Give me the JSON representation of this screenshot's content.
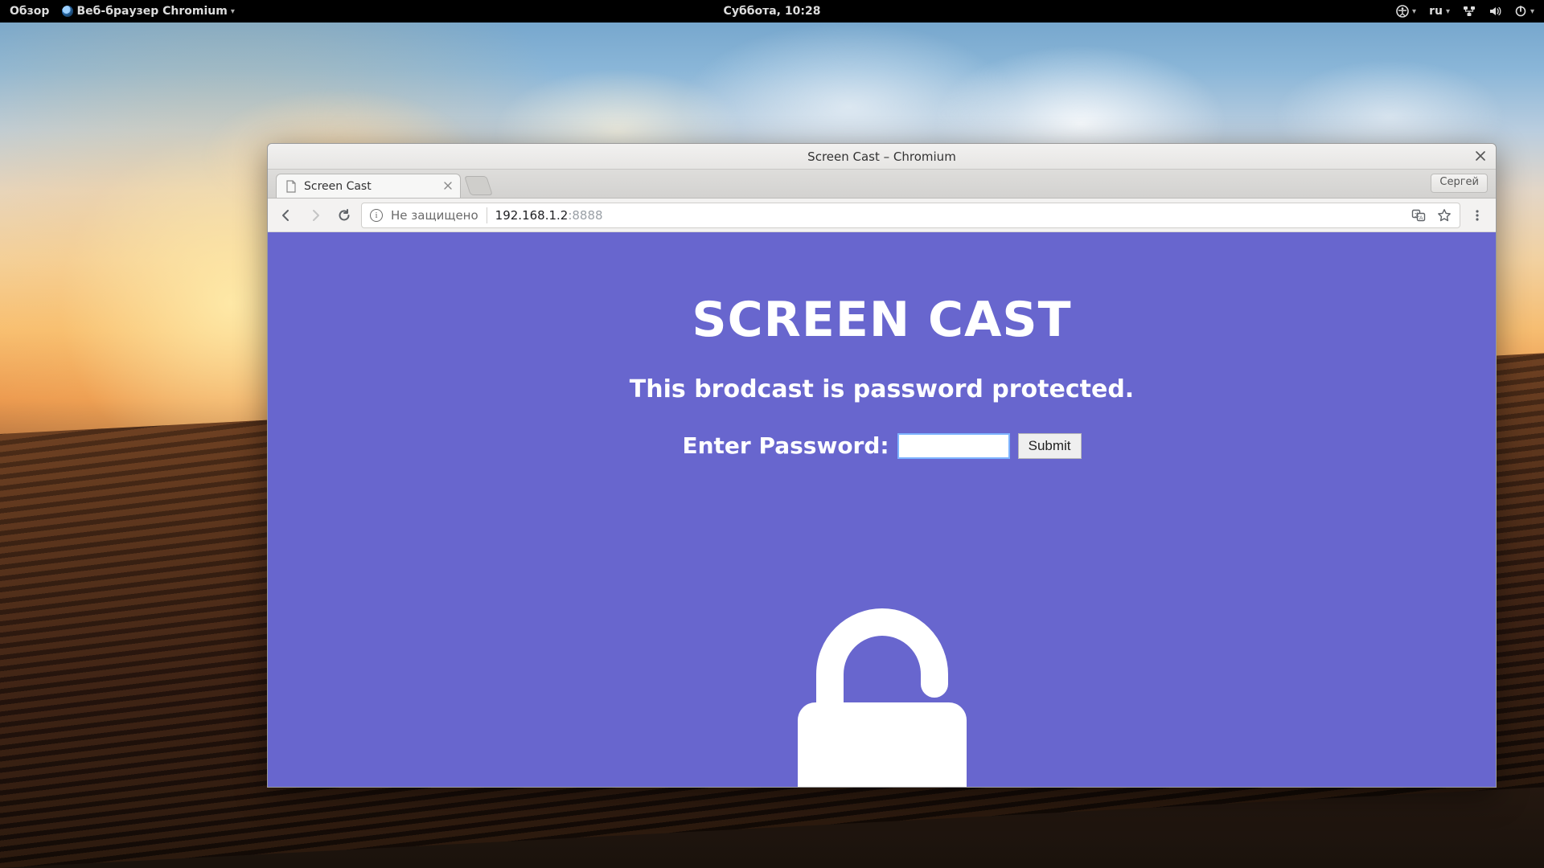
{
  "topbar": {
    "overview": "Обзор",
    "app_label": "Веб-браузер Chromium",
    "clock": "Суббота, 10:28",
    "lang": "ru"
  },
  "window": {
    "title": "Screen Cast – Chromium",
    "tab_title": "Screen Cast",
    "user_chip": "Сергей"
  },
  "omnibox": {
    "not_secure": "Не защищено",
    "host": "192.168.1.2",
    "port": ":8888"
  },
  "page": {
    "heading": "SCREEN CAST",
    "subheading": "This brodcast is password protected.",
    "password_label": "Enter Password:",
    "submit_label": "Submit"
  }
}
